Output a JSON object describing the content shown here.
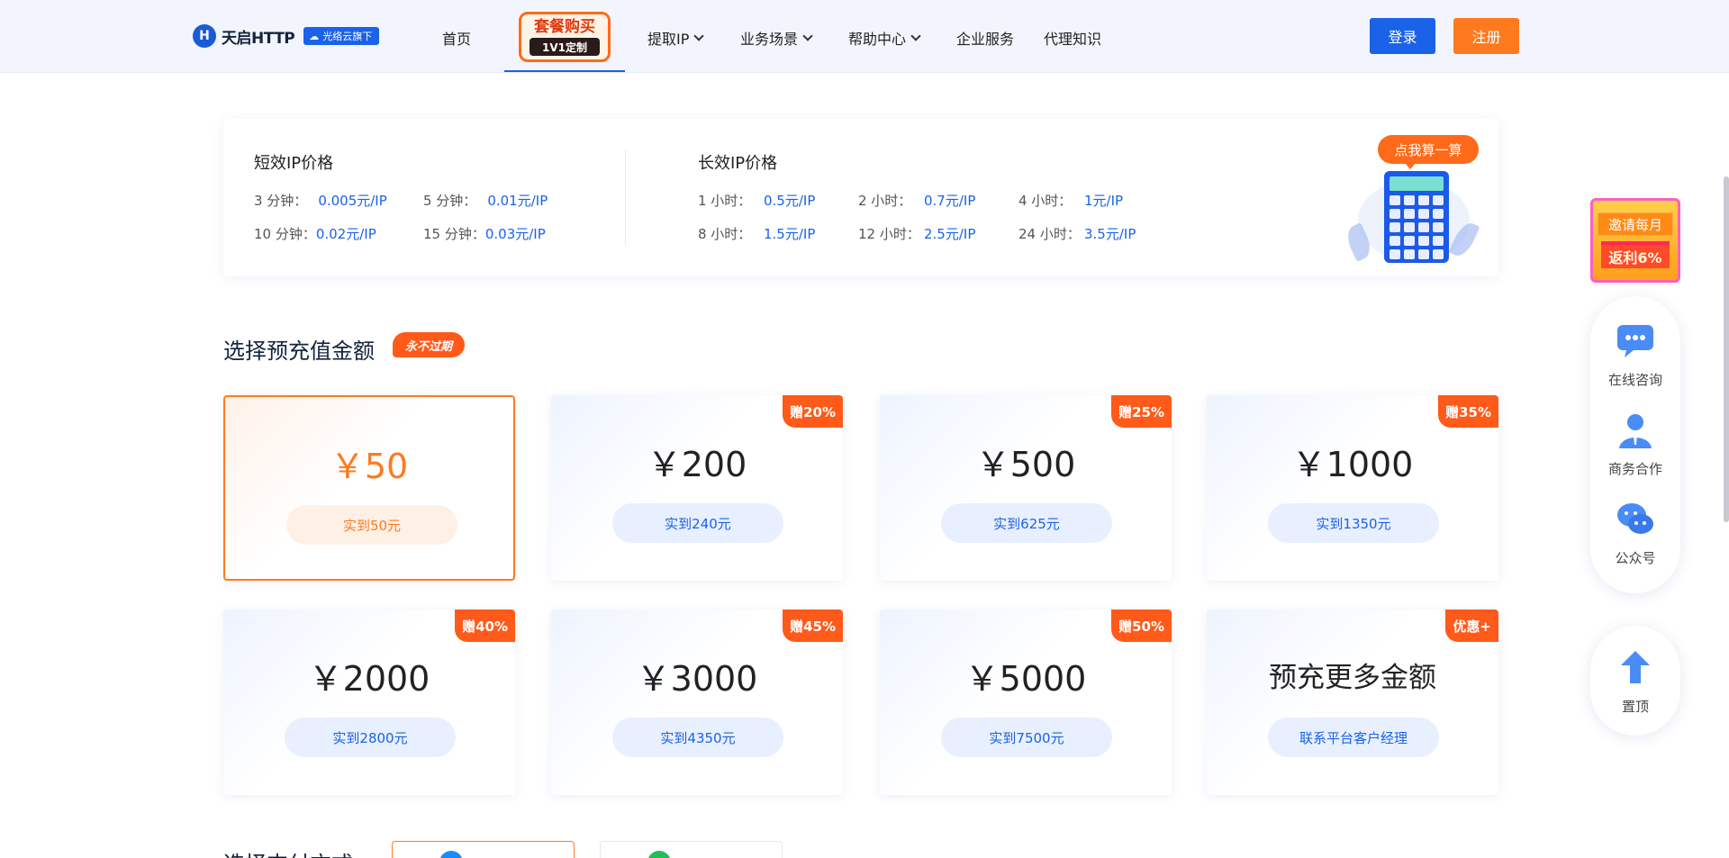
{
  "header": {
    "logo_mark": "H",
    "logo_text": "天启HTTP",
    "logo_badge": "光络云旗下",
    "nav": [
      {
        "label": "首页",
        "has_dropdown": false
      },
      {
        "label": "提取IP",
        "has_dropdown": true
      },
      {
        "label": "业务场景",
        "has_dropdown": true
      },
      {
        "label": "帮助中心",
        "has_dropdown": true
      },
      {
        "label": "企业服务",
        "has_dropdown": false
      },
      {
        "label": "代理知识",
        "has_dropdown": false
      }
    ],
    "promo_top": "套餐购买",
    "promo_bottom": "1V1定制",
    "login_label": "登录",
    "register_label": "注册"
  },
  "prices": {
    "short_title": "短效IP价格",
    "short_rows": [
      [
        {
          "label": "3 分钟：",
          "value": "0.005元/IP"
        },
        {
          "label": "5 分钟：",
          "value": "0.01元/IP"
        }
      ],
      [
        {
          "label": "10 分钟：",
          "value": "0.02元/IP"
        },
        {
          "label": "15 分钟：",
          "value": "0.03元/IP"
        }
      ]
    ],
    "long_title": "长效IP价格",
    "long_rows": [
      [
        {
          "label": "1 小时：",
          "value": "0.5元/IP"
        },
        {
          "label": "2 小时：",
          "value": "0.7元/IP"
        },
        {
          "label": "4 小时：",
          "value": "1元/IP"
        }
      ],
      [
        {
          "label": "8 小时：",
          "value": "1.5元/IP"
        },
        {
          "label": "12 小时：",
          "value": "2.5元/IP"
        },
        {
          "label": "24 小时：",
          "value": "3.5元/IP"
        }
      ]
    ],
    "calc_label": "点我算一算"
  },
  "recharge": {
    "title": "选择预充值金额",
    "tag": "永不过期",
    "cards": [
      {
        "amount": "￥50",
        "pill": "实到50元",
        "badge": "",
        "selected": true
      },
      {
        "amount": "￥200",
        "pill": "实到240元",
        "badge": "赠20%",
        "selected": false
      },
      {
        "amount": "￥500",
        "pill": "实到625元",
        "badge": "赠25%",
        "selected": false
      },
      {
        "amount": "￥1000",
        "pill": "实到1350元",
        "badge": "赠35%",
        "selected": false
      },
      {
        "amount": "￥2000",
        "pill": "实到2800元",
        "badge": "赠40%",
        "selected": false
      },
      {
        "amount": "￥3000",
        "pill": "实到4350元",
        "badge": "赠45%",
        "selected": false
      },
      {
        "amount": "￥5000",
        "pill": "实到7500元",
        "badge": "赠50%",
        "selected": false
      },
      {
        "amount": "预充更多金额",
        "pill": "联系平台客户经理",
        "badge": "优惠+",
        "selected": false
      }
    ]
  },
  "payment": {
    "title": "选择支付方式"
  },
  "side": {
    "invite_top": "邀请每月",
    "invite_bottom": "返利6%",
    "items": [
      {
        "label": "在线咨询",
        "icon": "chat-icon"
      },
      {
        "label": "商务合作",
        "icon": "person-icon"
      },
      {
        "label": "公众号",
        "icon": "wechat-icon"
      }
    ],
    "top_label": "置顶"
  },
  "colors": {
    "primary": "#1a62e8",
    "accent": "#ff7a1f",
    "badge": "#ff5a1a"
  }
}
